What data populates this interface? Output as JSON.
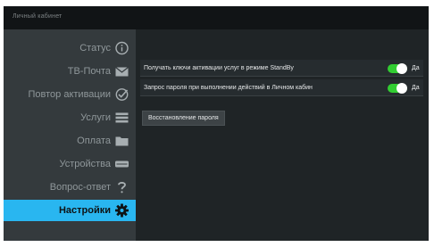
{
  "window": {
    "title": "Личный кабинет"
  },
  "sidebar": {
    "items": [
      {
        "label": "Статус",
        "icon": "info-circle-icon"
      },
      {
        "label": "ТВ-Почта",
        "icon": "envelope-icon"
      },
      {
        "label": "Повтор активации",
        "icon": "check-circle-icon"
      },
      {
        "label": "Услуги",
        "icon": "list-icon"
      },
      {
        "label": "Оплата",
        "icon": "folder-icon"
      },
      {
        "label": "Устройства",
        "icon": "device-icon"
      },
      {
        "label": "Вопрос-ответ",
        "icon": "question-icon"
      },
      {
        "label": "Настройки",
        "icon": "gear-icon",
        "active": true
      }
    ]
  },
  "settings": {
    "rows": [
      {
        "text": "Получать ключи активации услуг в режиме StandBy",
        "enabled": true,
        "value_label": "Да"
      },
      {
        "text": "Запрос пароля при выполнении действий в Личном кабин",
        "enabled": true,
        "value_label": "Да"
      }
    ],
    "button_label": "Восстановление пароля"
  },
  "colors": {
    "accent": "#29b6f0",
    "toggle_on": "#32cd32",
    "sidebar_bg": "#343a3d",
    "content_bg": "#1f2426"
  }
}
